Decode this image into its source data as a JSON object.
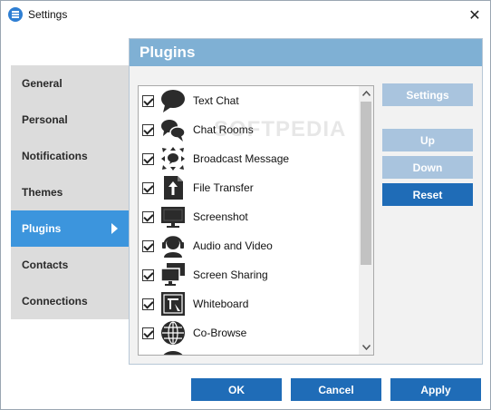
{
  "window": {
    "title": "Settings",
    "close_label": "✕"
  },
  "nav": {
    "items": [
      {
        "label": "General"
      },
      {
        "label": "Personal"
      },
      {
        "label": "Notifications"
      },
      {
        "label": "Themes"
      },
      {
        "label": "Plugins",
        "active": true
      },
      {
        "label": "Contacts"
      },
      {
        "label": "Connections"
      }
    ]
  },
  "panel": {
    "title": "Plugins"
  },
  "plugins": [
    {
      "label": "Text Chat",
      "icon": "text-chat-icon",
      "checked": true
    },
    {
      "label": "Chat Rooms",
      "icon": "chat-rooms-icon",
      "checked": true
    },
    {
      "label": "Broadcast Message",
      "icon": "broadcast-icon",
      "checked": true
    },
    {
      "label": "File Transfer",
      "icon": "file-transfer-icon",
      "checked": true
    },
    {
      "label": "Screenshot",
      "icon": "screenshot-icon",
      "checked": true
    },
    {
      "label": "Audio and Video",
      "icon": "audio-video-icon",
      "checked": true
    },
    {
      "label": "Screen Sharing",
      "icon": "screen-sharing-icon",
      "checked": true
    },
    {
      "label": "Whiteboard",
      "icon": "whiteboard-icon",
      "checked": true
    },
    {
      "label": "Co-Browse",
      "icon": "co-browse-icon",
      "checked": true
    }
  ],
  "side_buttons": {
    "settings": "Settings",
    "up": "Up",
    "down": "Down",
    "reset": "Reset"
  },
  "footer": {
    "ok": "OK",
    "cancel": "Cancel",
    "apply": "Apply"
  },
  "watermark": "SOFTPEDIA",
  "colors": {
    "accent": "#3c95dd",
    "primary_button": "#1f6cb7",
    "disabled_button": "#a9c4de",
    "panel_header": "#7fb0d4",
    "icon_dark": "#2b2b2b"
  }
}
